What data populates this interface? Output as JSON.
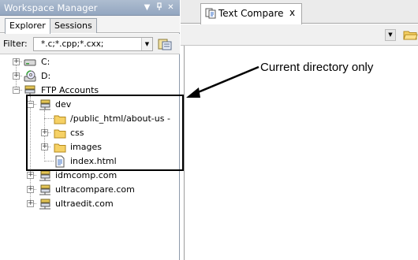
{
  "workspace": {
    "title": "Workspace Manager",
    "tabs": [
      {
        "label": "Explorer",
        "active": true
      },
      {
        "label": "Sessions",
        "active": false
      }
    ],
    "filter": {
      "label": "Filter:",
      "value": "*.c;*.cpp;*.cxx;"
    }
  },
  "tree": {
    "items": [
      {
        "label": "C:",
        "icon": "drive-icon",
        "expander": "+"
      },
      {
        "label": "D:",
        "icon": "cd-drive-icon",
        "expander": "+"
      },
      {
        "label": "FTP Accounts",
        "icon": "ftp-accounts-icon",
        "expander": "−"
      },
      {
        "label": "dev",
        "icon": "ftp-server-icon",
        "expander": "−"
      },
      {
        "label": "/public_html/about-us - ",
        "icon": "folder-icon",
        "expander": ""
      },
      {
        "label": "css",
        "icon": "folder-icon",
        "expander": "+"
      },
      {
        "label": "images",
        "icon": "folder-icon",
        "expander": "+"
      },
      {
        "label": "index.html",
        "icon": "file-icon",
        "expander": ""
      },
      {
        "label": "idmcomp.com",
        "icon": "ftp-server-icon",
        "expander": "+"
      },
      {
        "label": "ultracompare.com",
        "icon": "ftp-server-icon",
        "expander": "+"
      },
      {
        "label": "ultraedit.com",
        "icon": "ftp-server-icon",
        "expander": "+"
      }
    ]
  },
  "document": {
    "tab_label": "Text Compare",
    "close_label": "x"
  },
  "annotation": {
    "callout": "Current directory only"
  },
  "colors": {
    "title_bar": "#9fb0c8",
    "folder": "#f6d165",
    "highlight_border": "#000000"
  }
}
